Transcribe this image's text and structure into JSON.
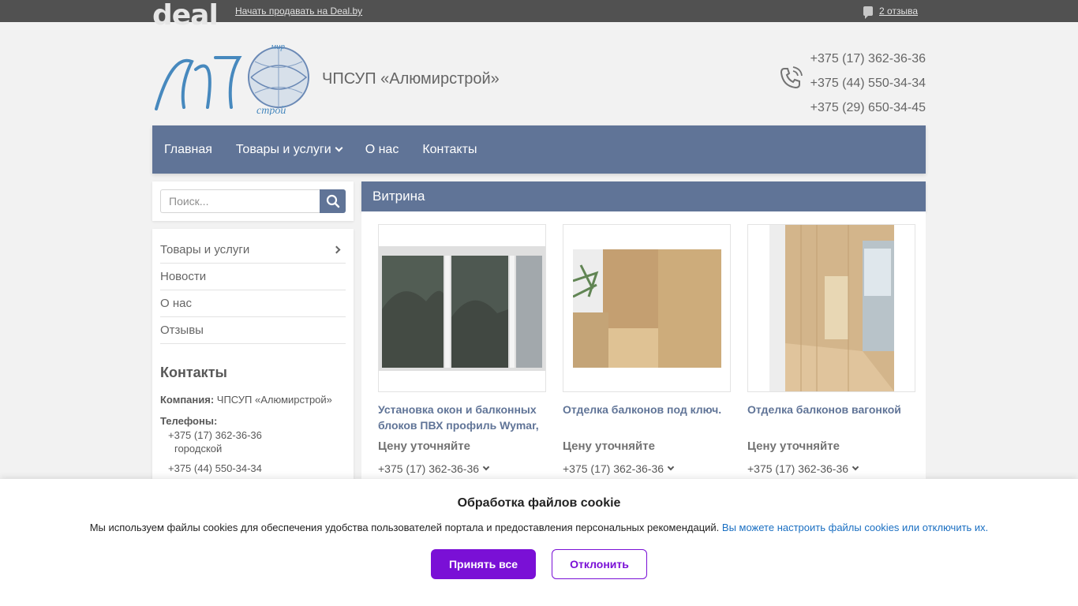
{
  "topbar": {
    "logo": "deal",
    "sell_link": "Начать продавать на Deal.by",
    "reviews_link": "2 отзыва"
  },
  "header": {
    "logo_text_top": "мир",
    "logo_text_bottom": "строй",
    "company": "ЧПСУП «Алюмирстрой»",
    "phones": [
      "+375 (17) 362-36-36",
      "+375 (44) 550-34-34",
      "+375 (29) 650-34-45"
    ]
  },
  "nav": {
    "items": [
      "Главная",
      "Товары и услуги",
      "О нас",
      "Контакты"
    ]
  },
  "sidebar": {
    "search_placeholder": "Поиск...",
    "menu": [
      "Товары и услуги",
      "Новости",
      "О нас",
      "Отзывы"
    ],
    "contacts_title": "Контакты",
    "company_label": "Компания:",
    "company_value": "ЧПСУП «Алюмирстрой»",
    "phones_label": "Телефоны:",
    "phone1": "+375 (17) 362-36-36",
    "phone1_note": "городской",
    "phone2": "+375 (44) 550-34-34"
  },
  "main": {
    "section_title": "Витрина",
    "products": [
      {
        "title": "Установка окон и балконных блоков ПВХ профиль Wymar,",
        "price": "Цену уточняйте",
        "phone": "+375 (17) 362-36-36"
      },
      {
        "title": "Отделка балконов под ключ.",
        "price": "Цену уточняйте",
        "phone": "+375 (17) 362-36-36"
      },
      {
        "title": "Отделка балконов вагонкой",
        "price": "Цену уточняйте",
        "phone": "+375 (17) 362-36-36"
      }
    ]
  },
  "cookie": {
    "title": "Обработка файлов cookie",
    "text": "Мы используем файлы cookies для обеспечения удобства пользователей портала и предоставления персональных рекомендаций.",
    "link": "Вы можете настроить файлы cookies или отключить их.",
    "accept": "Принять все",
    "decline": "Отклонить"
  },
  "colors": {
    "nav_bg": "#3d5680",
    "accent_purple": "#7a10d6",
    "link_blue": "#1a6fc2"
  }
}
